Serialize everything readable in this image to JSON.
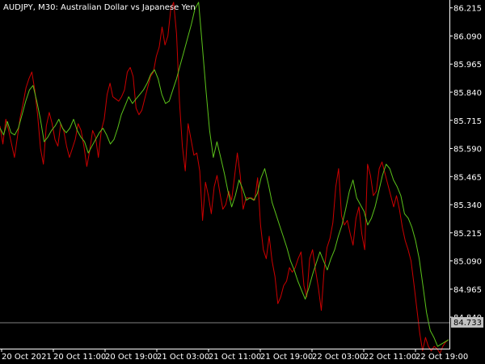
{
  "header": {
    "symbol": "AUDJPY",
    "timeframe": "M30:",
    "description": "Australian Dollar vs Japanese Yen"
  },
  "current_price": "84.733",
  "colors": {
    "background": "#000000",
    "axis": "#ffffff",
    "series_a": "#cc0000",
    "series_b": "#5bc21a",
    "price_line": "#808080",
    "price_label_bg": "#c0c0c0"
  },
  "chart_data": {
    "type": "line",
    "title": "",
    "xlabel": "",
    "ylabel": "",
    "ylim": [
      84.7,
      86.25
    ],
    "x_tick_labels": [
      "20 Oct 2021",
      "20 Oct 11:00",
      "20 Oct 19:00",
      "21 Oct 03:00",
      "21 Oct 11:00",
      "21 Oct 19:00",
      "22 Oct 03:00",
      "22 Oct 11:00",
      "22 Oct 19:00"
    ],
    "y_tick_labels": [
      "86.215",
      "86.090",
      "85.965",
      "85.840",
      "85.715",
      "85.590",
      "85.465",
      "85.340",
      "85.215",
      "85.090",
      "84.965",
      "84.840"
    ],
    "grid": false,
    "series": [
      {
        "color": "#cc0000",
        "values": [
          85.69,
          85.61,
          85.72,
          85.67,
          85.61,
          85.55,
          85.64,
          85.73,
          85.79,
          85.86,
          85.9,
          85.93,
          85.85,
          85.74,
          85.59,
          85.52,
          85.69,
          85.75,
          85.7,
          85.63,
          85.6,
          85.7,
          85.67,
          85.6,
          85.55,
          85.59,
          85.63,
          85.7,
          85.67,
          85.6,
          85.51,
          85.58,
          85.67,
          85.64,
          85.55,
          85.67,
          85.72,
          85.83,
          85.88,
          85.82,
          85.81,
          85.8,
          85.82,
          85.85,
          85.93,
          85.95,
          85.91,
          85.77,
          85.74,
          85.76,
          85.81,
          85.86,
          85.91,
          85.93,
          86.0,
          86.04,
          86.13,
          86.05,
          86.09,
          86.21,
          86.24,
          86.1,
          85.8,
          85.6,
          85.49,
          85.7,
          85.63,
          85.56,
          85.57,
          85.49,
          85.27,
          85.44,
          85.38,
          85.3,
          85.42,
          85.47,
          85.39,
          85.32,
          85.34,
          85.4,
          85.36,
          85.46,
          85.57,
          85.47,
          85.32,
          85.37,
          85.37,
          85.37,
          85.36,
          85.46,
          85.25,
          85.14,
          85.1,
          85.2,
          85.09,
          85.02,
          84.9,
          84.93,
          84.98,
          85.0,
          85.06,
          85.04,
          85.06,
          85.1,
          85.13,
          84.98,
          84.93,
          85.1,
          85.14,
          85.05,
          84.97,
          84.87,
          85.05,
          85.15,
          85.19,
          85.26,
          85.42,
          85.5,
          85.29,
          85.25,
          85.27,
          85.21,
          85.16,
          85.28,
          85.33,
          85.21,
          85.14,
          85.52,
          85.47,
          85.38,
          85.4,
          85.5,
          85.53,
          85.48,
          85.43,
          85.38,
          85.33,
          85.38,
          85.32,
          85.24,
          85.18,
          85.14,
          85.09,
          84.99,
          84.88,
          84.77,
          84.69,
          84.75,
          84.71,
          84.69,
          84.71,
          84.7,
          84.68,
          84.71,
          84.73,
          84.74
        ]
      },
      {
        "color": "#5bc21a",
        "values": [
          85.68,
          85.65,
          85.71,
          85.66,
          85.65,
          85.68,
          85.74,
          85.8,
          85.85,
          85.87,
          85.8,
          85.72,
          85.62,
          85.64,
          85.67,
          85.69,
          85.72,
          85.68,
          85.66,
          85.68,
          85.72,
          85.67,
          85.64,
          85.62,
          85.57,
          85.6,
          85.63,
          85.66,
          85.68,
          85.65,
          85.61,
          85.63,
          85.68,
          85.74,
          85.78,
          85.82,
          85.79,
          85.81,
          85.83,
          85.85,
          85.88,
          85.92,
          85.94,
          85.9,
          85.83,
          85.79,
          85.8,
          85.85,
          85.9,
          85.96,
          86.02,
          86.08,
          86.14,
          86.21,
          86.24,
          86.05,
          85.85,
          85.67,
          85.55,
          85.62,
          85.55,
          85.48,
          85.4,
          85.33,
          85.38,
          85.45,
          85.41,
          85.36,
          85.37,
          85.36,
          85.39,
          85.46,
          85.5,
          85.43,
          85.35,
          85.3,
          85.25,
          85.2,
          85.15,
          85.09,
          85.05,
          85.0,
          84.96,
          84.92,
          84.97,
          85.03,
          85.08,
          85.13,
          85.09,
          85.05,
          85.1,
          85.14,
          85.2,
          85.25,
          85.32,
          85.4,
          85.45,
          85.37,
          85.34,
          85.31,
          85.25,
          85.28,
          85.33,
          85.4,
          85.47,
          85.52,
          85.5,
          85.45,
          85.42,
          85.38,
          85.3,
          85.28,
          85.24,
          85.18,
          85.1,
          84.98,
          84.86,
          84.78,
          84.75,
          84.71,
          84.72,
          84.73,
          84.74
        ]
      }
    ]
  }
}
